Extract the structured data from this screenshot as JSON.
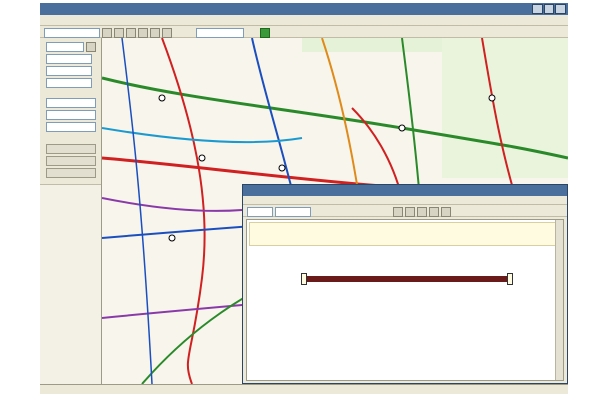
{
  "app": {
    "colors": {
      "accent": "#4a6f9c",
      "chrome": "#ece9d8",
      "route_line": "#6b1a1a",
      "jr_line": "#2a8a2a",
      "private_line": "#d02020"
    }
  },
  "route_window": {
    "icons": [
      "close-icon",
      "print-icon",
      "copy-icon",
      "save-icon",
      "map-icon"
    ]
  }
}
